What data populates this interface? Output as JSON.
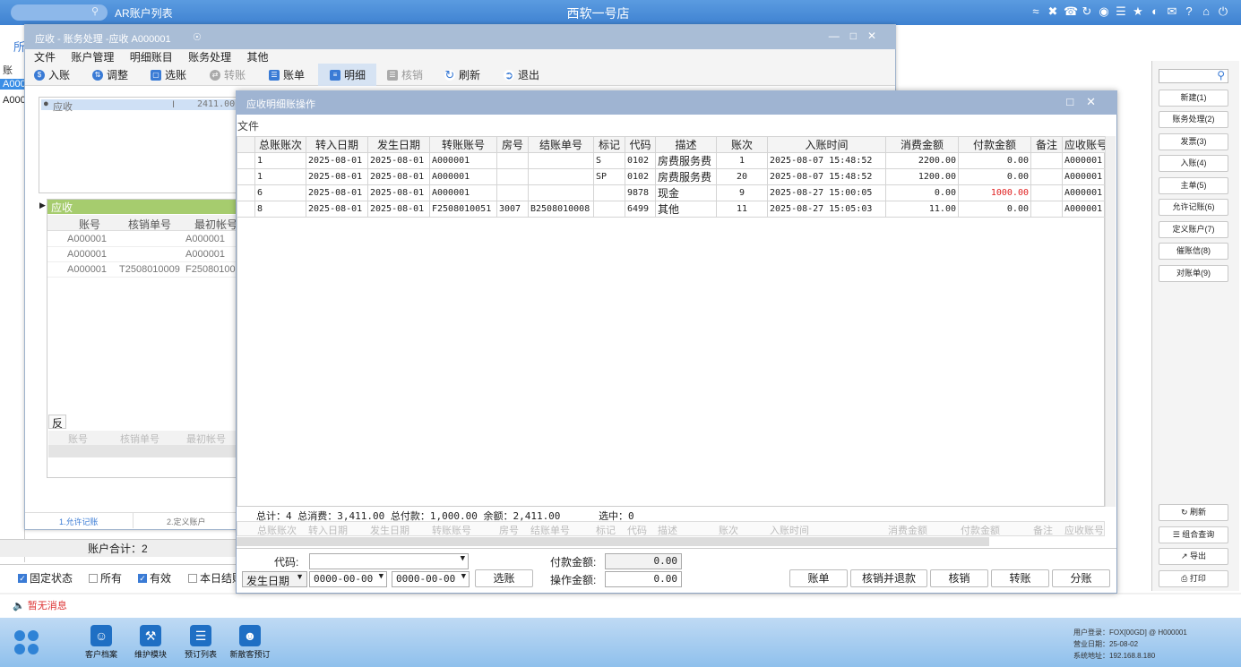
{
  "topbar": {
    "app_list": "AR账户列表",
    "hotel": "西软一号店",
    "icons": [
      "wifi-icon",
      "tools-icon",
      "phone-icon",
      "refresh-icon",
      "palette-icon",
      "menu-icon",
      "star-icon",
      "moon-icon",
      "mail-icon",
      "help-icon",
      "home-icon",
      "power-icon"
    ]
  },
  "bg": {
    "tab_label": "所",
    "col_header": "账",
    "rows": [
      "A000",
      "A000"
    ],
    "account_total": "账户合计：2",
    "checks": [
      {
        "label": "固定状态",
        "checked": true
      },
      {
        "label": "所有",
        "checked": false
      },
      {
        "label": "有效",
        "checked": true
      },
      {
        "label": "本日结账",
        "checked": false
      }
    ],
    "message": "暂无消息"
  },
  "right_panel": {
    "buttons": [
      "新建(1)",
      "账务处理(2)",
      "发票(3)",
      "入账(4)",
      "主单(5)",
      "允许记账(6)",
      "定义账户(7)",
      "催账信(8)",
      "对账单(9)"
    ],
    "bottom_buttons": [
      "刷新",
      "组合查询",
      "导出",
      "打印"
    ]
  },
  "dock": {
    "items": [
      "客户档案",
      "维护模块",
      "预订列表",
      "新散客预订"
    ],
    "user_login": "用户登录：FOX[00GD] @ H000001",
    "biz_date": "营业日期：25-08-02",
    "sys_addr": "系统地址：192.168.8.180"
  },
  "mid": {
    "title": "应收 - 账务处理 -应收  A000001",
    "menu": [
      "文件",
      "账户管理",
      "明细账目",
      "账务处理",
      "其他"
    ],
    "toolbar": [
      {
        "label": "入账",
        "enabled": true
      },
      {
        "label": "调整",
        "enabled": true
      },
      {
        "label": "选账",
        "enabled": true
      },
      {
        "label": "转账",
        "enabled": false
      },
      {
        "label": "账单",
        "enabled": true
      },
      {
        "label": "明细",
        "enabled": true
      },
      {
        "label": "核销",
        "enabled": false
      },
      {
        "label": "刷新",
        "enabled": true
      },
      {
        "label": "退出",
        "enabled": true
      }
    ],
    "tree": {
      "name": "应收",
      "flag": "I",
      "amount": "2411.00"
    },
    "ar_header": "应收",
    "ar_cols": [
      "账号",
      "核销单号",
      "最初帐号"
    ],
    "ar_rows": [
      [
        "A000001",
        "",
        "A000001"
      ],
      [
        "A000001",
        "",
        "A000001"
      ],
      [
        "A000001",
        "T2508010009",
        "F250801005"
      ]
    ],
    "fan_label": "反",
    "fan_cols": [
      "账号",
      "核销单号",
      "最初帐号"
    ],
    "bottom_tabs": [
      "1.允许记账",
      "2.定义账户"
    ]
  },
  "dlg": {
    "title": "应收明细账操作",
    "menu": "文件",
    "columns": [
      "总账账次",
      "转入日期",
      "发生日期",
      "转账账号",
      "房号",
      "结账单号",
      "标记",
      "代码",
      "描述",
      "账次",
      "入账时间",
      "消费金额",
      "付款金额",
      "备注",
      "应收账号"
    ],
    "rows": [
      [
        "1",
        "2025-08-01",
        "2025-08-01",
        "A000001",
        "",
        "",
        "S",
        "0102",
        "房费服务费",
        "1",
        "2025-08-07 15:48:52",
        "2200.00",
        "0.00",
        "",
        "A000001"
      ],
      [
        "1",
        "2025-08-01",
        "2025-08-01",
        "A000001",
        "",
        "",
        "SP",
        "0102",
        "房费服务费",
        "20",
        "2025-08-07 15:48:52",
        "1200.00",
        "0.00",
        "",
        "A000001"
      ],
      [
        "6",
        "2025-08-01",
        "2025-08-01",
        "A000001",
        "",
        "",
        "",
        "9878",
        "现金",
        "9",
        "2025-08-27 15:00:05",
        "0.00",
        "1000.00",
        "",
        "A000001"
      ],
      [
        "8",
        "2025-08-01",
        "2025-08-01",
        "F2508010051",
        "3007",
        "B2508010008",
        "",
        "6499",
        "其他",
        "11",
        "2025-08-27 15:05:03",
        "11.00",
        "0.00",
        "",
        "A000001"
      ]
    ],
    "summary": "总计：4 总消费：3,411.00 总付款：1,000.00 余额：2,411.00",
    "selected": "选中：0",
    "form": {
      "code_label": "代码:",
      "code_value": "",
      "date_type": "发生日期",
      "date_from": "0000-00-00",
      "date_to": "0000-00-00",
      "select_btn": "选账",
      "pay_label": "付款金额:",
      "pay_value": "0.00",
      "op_label": "操作金额:",
      "op_value": "0.00"
    },
    "actions": [
      "账单",
      "核销并退款",
      "核销",
      "转账",
      "分账"
    ]
  },
  "colors": {
    "accent": "#3f82d1",
    "green_header": "#a6cc6e",
    "red_value": "#e02020"
  }
}
